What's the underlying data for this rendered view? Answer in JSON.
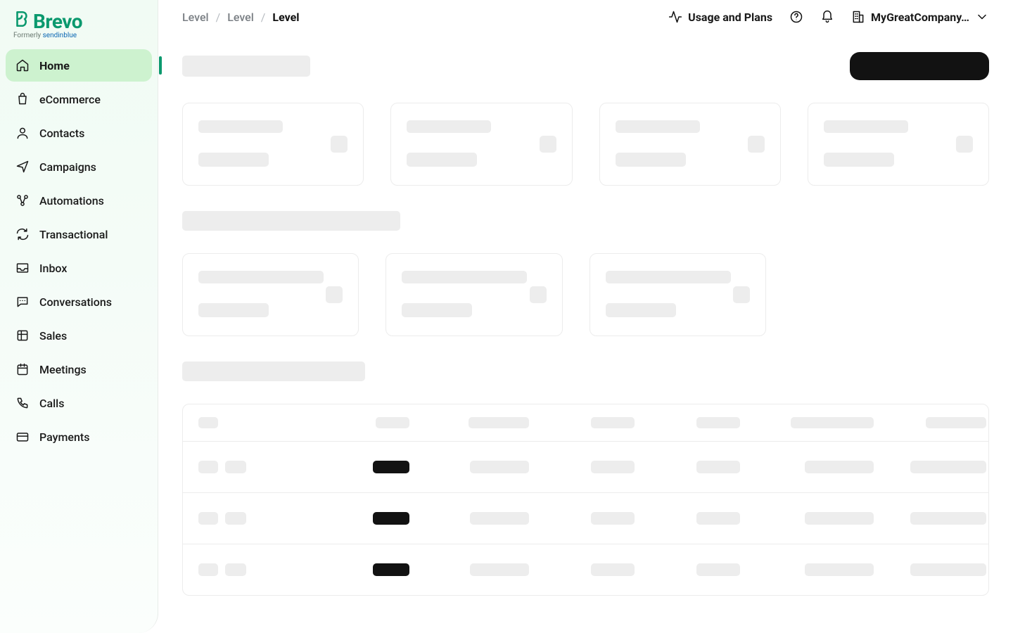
{
  "brand": {
    "name": "Brevo",
    "tagline_prefix": "Formerly",
    "tagline_old": "sendinblue"
  },
  "sidebar": {
    "items": [
      {
        "id": "home",
        "label": "Home",
        "icon": "home-icon",
        "active": true
      },
      {
        "id": "ecommerce",
        "label": "eCommerce",
        "icon": "bag-icon",
        "active": false
      },
      {
        "id": "contacts",
        "label": "Contacts",
        "icon": "user-icon",
        "active": false
      },
      {
        "id": "campaigns",
        "label": "Campaigns",
        "icon": "send-icon",
        "active": false
      },
      {
        "id": "automations",
        "label": "Automations",
        "icon": "nodes-icon",
        "active": false
      },
      {
        "id": "transactional",
        "label": "Transactional",
        "icon": "refresh-icon",
        "active": false
      },
      {
        "id": "inbox",
        "label": "Inbox",
        "icon": "inbox-icon",
        "active": false
      },
      {
        "id": "conversations",
        "label": "Conversations",
        "icon": "chat-icon",
        "active": false
      },
      {
        "id": "sales",
        "label": "Sales",
        "icon": "grid-icon",
        "active": false
      },
      {
        "id": "meetings",
        "label": "Meetings",
        "icon": "calendar-icon",
        "active": false
      },
      {
        "id": "calls",
        "label": "Calls",
        "icon": "phone-icon",
        "active": false
      },
      {
        "id": "payments",
        "label": "Payments",
        "icon": "card-icon",
        "active": false
      }
    ]
  },
  "breadcrumbs": [
    {
      "label": "Level",
      "current": false
    },
    {
      "label": "Level",
      "current": false
    },
    {
      "label": "Level",
      "current": true
    }
  ],
  "topbar": {
    "usage_label": "Usage and Plans",
    "company_label": "MyGreatCompany…"
  }
}
